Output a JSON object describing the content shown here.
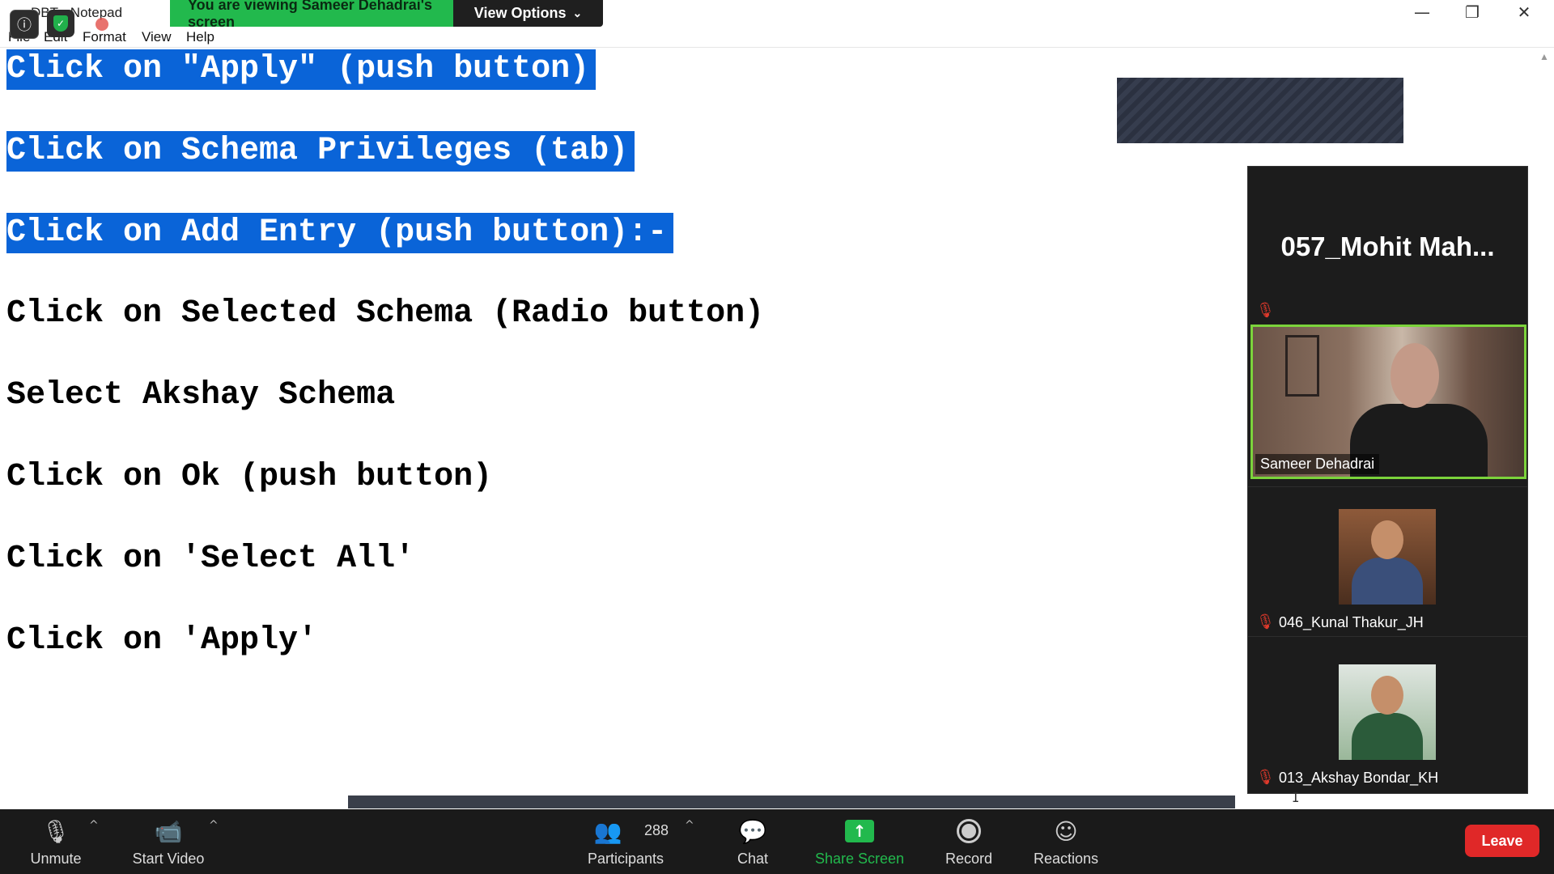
{
  "notepad": {
    "title": "DBT - Notepad",
    "menu": [
      "File",
      "Edit",
      "Format",
      "View",
      "Help"
    ],
    "window_controls": {
      "minimize": "—",
      "restore": "❐",
      "close": "✕"
    },
    "lines": [
      {
        "text": "Click on \"Apply\" (push button)",
        "selected": true
      },
      {
        "text": "Click on Schema Privileges (tab)",
        "selected": true
      },
      {
        "text": "Click on Add Entry (push button):-",
        "selected": true
      },
      {
        "text": "Click on Selected Schema (Radio button)",
        "selected": false
      },
      {
        "text": "Select Akshay Schema",
        "selected": false
      },
      {
        "text": "Click on Ok (push button)",
        "selected": false
      },
      {
        "text": "Click on 'Select All'",
        "selected": false
      },
      {
        "text": "Click on 'Apply'",
        "selected": false
      }
    ],
    "selection_color": "#0a64d8"
  },
  "share_banner": {
    "viewing_text": "You are viewing Sameer Dehadrai's screen",
    "view_options_label": "View Options",
    "color": "#22b94d"
  },
  "participants_panel": {
    "active_speaker": "057_Mohit Mah...",
    "video_tile_label": "Sameer Dehadrai",
    "participants": [
      {
        "name": "046_Kunal Thakur_JH",
        "muted": true
      },
      {
        "name": "013_Akshay Bondar_KH",
        "muted": true
      }
    ]
  },
  "toolbar": {
    "unmute": "Unmute",
    "start_video": "Start Video",
    "participants": "Participants",
    "participant_count": "288",
    "chat": "Chat",
    "share_screen": "Share Screen",
    "record": "Record",
    "reactions": "Reactions",
    "leave": "Leave",
    "leave_color": "#e02828",
    "share_color": "#22b94d"
  }
}
